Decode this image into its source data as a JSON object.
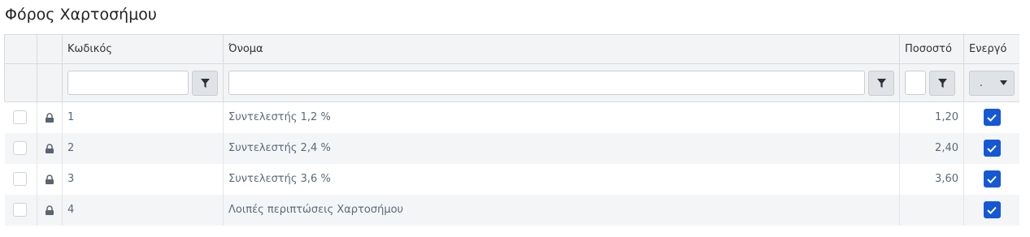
{
  "title": "Φόρος Χαρτοσήμου",
  "columns": {
    "code": "Κωδικός",
    "name": "Όνομα",
    "percent": "Ποσοστό",
    "active": "Ενεργό"
  },
  "filters": {
    "code_value": "",
    "name_value": "",
    "percent_value": "",
    "active_selected": "."
  },
  "rows": [
    {
      "code": "1",
      "name": "Συντελεστής 1,2 %",
      "percent": "1,20",
      "active": true
    },
    {
      "code": "2",
      "name": "Συντελεστής 2,4 %",
      "percent": "2,40",
      "active": true
    },
    {
      "code": "3",
      "name": "Συντελεστής 3,6 %",
      "percent": "3,60",
      "active": true
    },
    {
      "code": "4",
      "name": "Λοιπές περιπτώσεις Χαρτοσήμου",
      "percent": "",
      "active": true
    }
  ],
  "icons": {
    "filter": "filter-icon",
    "lock": "lock-icon",
    "check": "check-icon",
    "dropdown": "caret-down-icon"
  },
  "colors": {
    "accent": "#1558d6",
    "header_bg": "#f3f4f5"
  }
}
